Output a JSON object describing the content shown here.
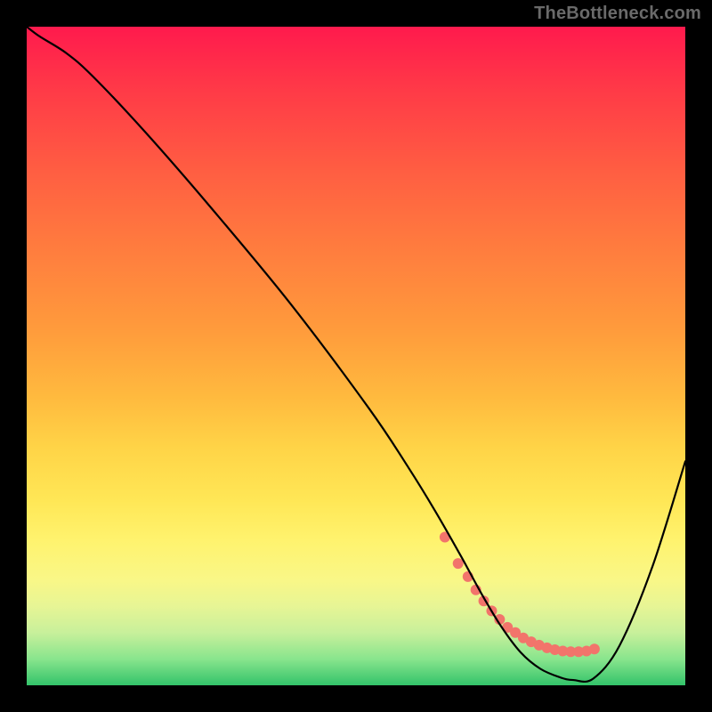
{
  "watermark": "TheBottleneck.com",
  "chart_data": {
    "type": "line",
    "title": "",
    "xlabel": "",
    "ylabel": "",
    "xlim": [
      0,
      100
    ],
    "ylim": [
      0,
      100
    ],
    "series": [
      {
        "name": "bottleneck-curve",
        "x": [
          0,
          2,
          6,
          10,
          18,
          28,
          40,
          52,
          58,
          62,
          66,
          69,
          72,
          75,
          78,
          81,
          83,
          86,
          90,
          95,
          100
        ],
        "y": [
          100,
          98.5,
          96,
          92.5,
          84,
          72.5,
          58,
          42,
          33,
          26.5,
          19.5,
          14,
          9,
          5,
          2.5,
          1.2,
          0.8,
          1,
          6,
          18,
          34
        ],
        "stroke": "#000000",
        "width": 2.2
      }
    ],
    "marker_series": {
      "name": "optimal-range-dots",
      "x": [
        63.5,
        65.5,
        67,
        68.2,
        69.4,
        70.6,
        71.8,
        73,
        74.2,
        75.4,
        76.6,
        77.8,
        79,
        80.2,
        81.4,
        82.6,
        83.8,
        85,
        86.2
      ],
      "y": [
        22.5,
        18.5,
        16.5,
        14.5,
        12.8,
        11.3,
        10,
        8.8,
        8,
        7.2,
        6.6,
        6.1,
        5.7,
        5.4,
        5.2,
        5.1,
        5.1,
        5.2,
        5.5
      ],
      "color": "#f2746b",
      "radius": 6
    }
  }
}
